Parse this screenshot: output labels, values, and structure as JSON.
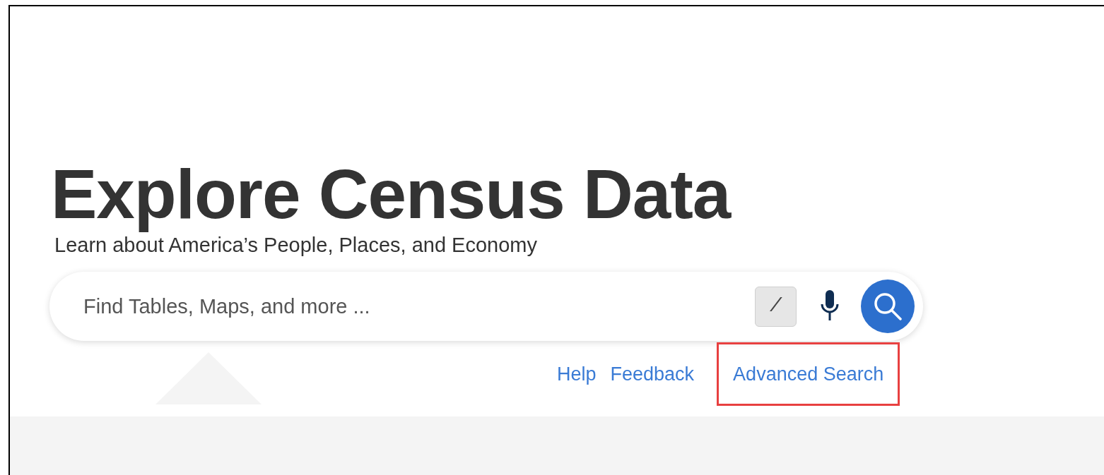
{
  "heading": "Explore Census Data",
  "subheading": "Learn about America’s People, Places, and Economy",
  "search": {
    "placeholder": "Find Tables, Maps, and more ...",
    "shortcut_key": "/"
  },
  "links": [
    {
      "label": "Help",
      "highlighted": false
    },
    {
      "label": "Feedback",
      "highlighted": false
    },
    {
      "label": "Advanced Search",
      "highlighted": true
    }
  ]
}
